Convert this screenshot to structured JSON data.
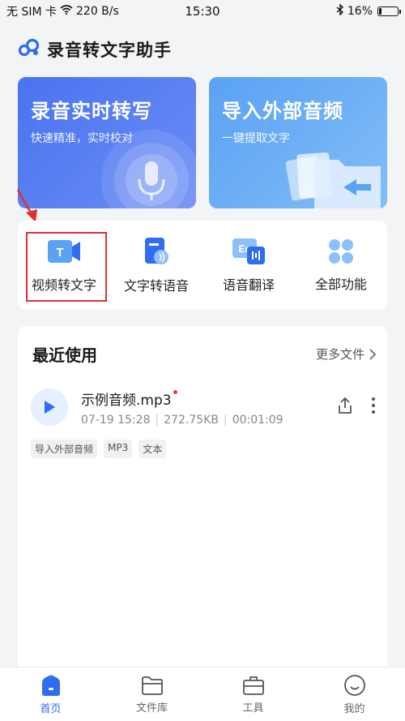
{
  "status_bar": {
    "carrier": "无 SIM 卡",
    "speed": "220 B/s",
    "time": "15:30",
    "battery_text": "16%",
    "battery_level": 0.16
  },
  "header": {
    "title": "录音转文字助手"
  },
  "hero": {
    "record": {
      "title": "录音实时转写",
      "subtitle": "快速精准，实时校对"
    },
    "import": {
      "title": "导入外部音频",
      "subtitle": "一键提取文字"
    }
  },
  "features": [
    {
      "label": "视频转文字",
      "icon": "video-icon"
    },
    {
      "label": "文字转语音",
      "icon": "text-to-speech-icon"
    },
    {
      "label": "语音翻译",
      "icon": "translate-icon"
    },
    {
      "label": "全部功能",
      "icon": "grid-icon"
    }
  ],
  "recent": {
    "title": "最近使用",
    "more_label": "更多文件",
    "file": {
      "name": "示例音频.mp3",
      "date": "07-19 15:28",
      "size": "272.75KB",
      "duration": "00:01:09",
      "tags": [
        "导入外部音频",
        "MP3",
        "文本"
      ]
    }
  },
  "nav": [
    {
      "label": "首页",
      "icon": "home-icon",
      "active": true
    },
    {
      "label": "文件库",
      "icon": "folder-icon",
      "active": false
    },
    {
      "label": "工具",
      "icon": "toolbox-icon",
      "active": false
    },
    {
      "label": "我的",
      "icon": "profile-icon",
      "active": false
    }
  ],
  "colors": {
    "accent": "#2f6cf0",
    "hero_record": "#4a73f0",
    "hero_import": "#5aa2f4",
    "highlight": "#e03030"
  }
}
